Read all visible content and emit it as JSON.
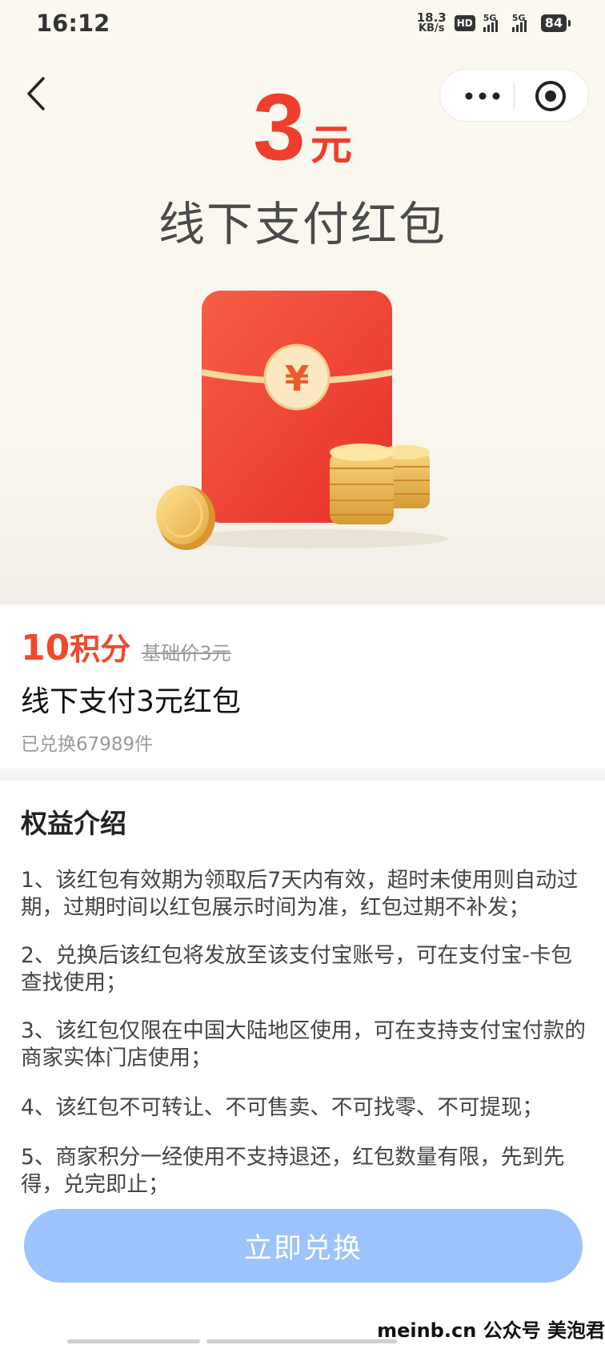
{
  "status_bar": {
    "time": "16:12",
    "net_speed_value": "18.3",
    "net_speed_unit": "KB/s",
    "hd_badge": "HD",
    "sim1_label": "5G",
    "sim2_label": "5G",
    "battery": "84"
  },
  "nav": {
    "back_icon": "chevron-left-icon",
    "more_icon": "more-dots-icon",
    "close_icon": "target-circle-icon"
  },
  "hero": {
    "amount": "3",
    "amount_unit": "元",
    "title": "线下支付红包",
    "envelope_symbol": "¥",
    "colors": {
      "amount": "#ef3e2c",
      "envelope": "#f04634",
      "gold": "#f2c35a"
    }
  },
  "product": {
    "points": "10",
    "points_unit": "积分",
    "base_price": "基础价3元",
    "title": "线下支付3元红包",
    "redeemed": "已兑换67989件"
  },
  "benefits": {
    "title": "权益介绍",
    "items": [
      "1、该红包有效期为领取后7天内有效，超时未使用则自动过期，过期时间以红包展示时间为准，红包过期不补发；",
      "2、兑换后该红包将发放至该支付宝账号，可在支付宝-卡包查找使用；",
      "3、该红包仅限在中国大陆地区使用，可在支持支付宝付款的商家实体门店使用；",
      "4、该红包不可转让、不可售卖、不可找零、不可提现；",
      "5、商家积分一经使用不支持退还，红包数量有限，先到先得，兑完即止；"
    ]
  },
  "action": {
    "redeem_label": "立即兑换",
    "color": "#9cc3fb"
  },
  "watermark": "meinb.cn  公众号 美泡君"
}
